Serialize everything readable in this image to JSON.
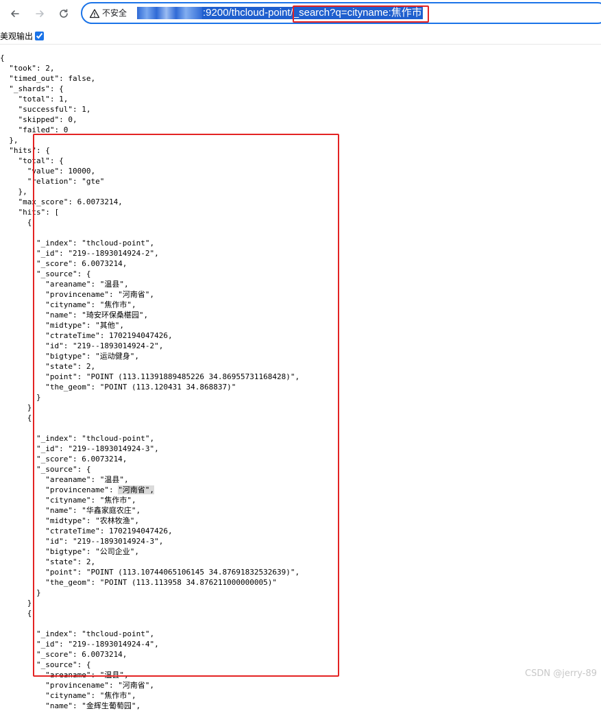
{
  "browser": {
    "insecure_label": "不安全",
    "url_visible": ":9200/thcloud-point/_search?q=cityname:焦作市"
  },
  "view_options": {
    "pretty_print_label": "美观输出",
    "pretty_print_checked": true
  },
  "json_lines": [
    "{",
    "  \"took\": 2,",
    "  \"timed_out\": false,",
    "  \"_shards\": {",
    "    \"total\": 1,",
    "    \"successful\": 1,",
    "    \"skipped\": 0,",
    "    \"failed\": 0",
    "  },",
    "  \"hits\": {",
    "    \"total\": {",
    "      \"value\": 10000,",
    "      \"relation\": \"gte\"",
    "    },",
    "    \"max_score\": 6.0073214,",
    "    \"hits\": [",
    "      {",
    "",
    "        \"_index\": \"thcloud-point\",",
    "        \"_id\": \"219--1893014924-2\",",
    "        \"_score\": 6.0073214,",
    "        \"_source\": {",
    "          \"areaname\": \"温县\",",
    "          \"provincename\": \"河南省\",",
    "          \"cityname\": \"焦作市\",",
    "          \"name\": \"琦安环保桑椹园\",",
    "          \"midtype\": \"其他\",",
    "          \"ctrateTime\": 1702194047426,",
    "          \"id\": \"219--1893014924-2\",",
    "          \"bigtype\": \"运动健身\",",
    "          \"state\": 2,",
    "          \"point\": \"POINT (113.11391889485226 34.86955731168428)\",",
    "          \"the_geom\": \"POINT (113.120431 34.868837)\"",
    "        }",
    "      }",
    "      {",
    "",
    "        \"_index\": \"thcloud-point\",",
    "        \"_id\": \"219--1893014924-3\",",
    "        \"_score\": 6.0073214,",
    "        \"_source\": {",
    "          \"areaname\": \"温县\",",
    "          \"provincename\": \"河南省\",",
    "          \"cityname\": \"焦作市\",",
    "          \"name\": \"华鑫家庭农庄\",",
    "          \"midtype\": \"农林牧渔\",",
    "          \"ctrateTime\": 1702194047426,",
    "          \"id\": \"219--1893014924-3\",",
    "          \"bigtype\": \"公司企业\",",
    "          \"state\": 2,",
    "          \"point\": \"POINT (113.10744065106145 34.87691832532639)\",",
    "          \"the_geom\": \"POINT (113.113958 34.876211000000005)\"",
    "        }",
    "      }",
    "      {",
    "",
    "        \"_index\": \"thcloud-point\",",
    "        \"_id\": \"219--1893014924-4\",",
    "        \"_score\": 6.0073214,",
    "        \"_source\": {",
    "          \"areaname\": \"温县\",",
    "          \"provincename\": \"河南省\",",
    "          \"cityname\": \"焦作市\",",
    "          \"name\": \"金辉生葡萄园\","
  ],
  "watermark": "CSDN @jerry-89",
  "colors": {
    "accent": "#1a73e8",
    "annotation_red": "#e32222",
    "selection": "#1f5fce"
  }
}
